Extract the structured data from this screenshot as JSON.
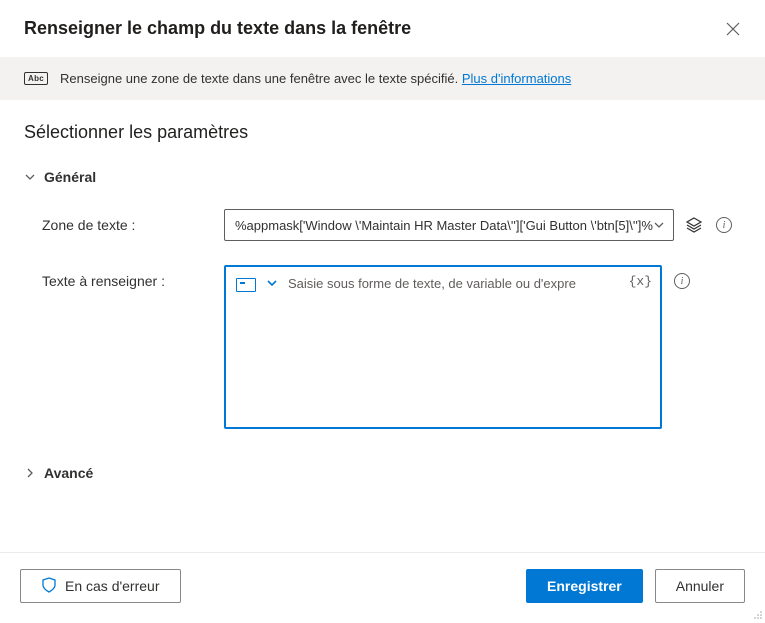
{
  "dialog": {
    "title": "Renseigner le champ du texte dans la fenêtre"
  },
  "infobar": {
    "icon_label": "Abc",
    "text": "Renseigne une zone de texte dans une fenêtre avec le texte spécifié. ",
    "link": "Plus d'informations"
  },
  "params": {
    "section_title": "Sélectionner les paramètres",
    "general_label": "Général",
    "textbox_label": "Zone de texte :",
    "textbox_value": "%appmask['Window \\'Maintain HR Master Data\\'']['Gui Button \\'btn[5]\\'']%",
    "texttofill_label": "Texte à renseigner :",
    "texttofill_placeholder": "Saisie sous forme de texte, de variable ou d'expre",
    "var_token": "{x}",
    "advanced_label": "Avancé"
  },
  "footer": {
    "on_error": "En cas d'erreur",
    "save": "Enregistrer",
    "cancel": "Annuler"
  }
}
